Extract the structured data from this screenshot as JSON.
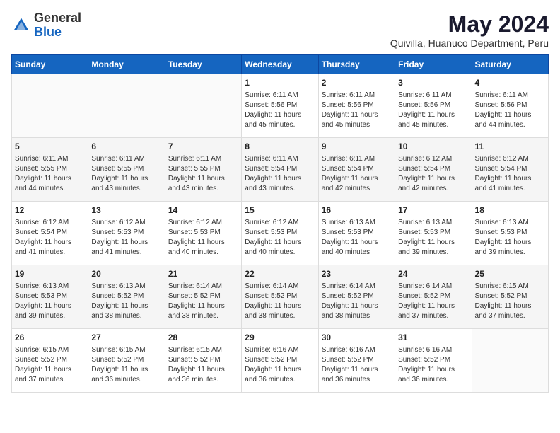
{
  "header": {
    "logo_general": "General",
    "logo_blue": "Blue",
    "month_year": "May 2024",
    "location": "Quivilla, Huanuco Department, Peru"
  },
  "days_of_week": [
    "Sunday",
    "Monday",
    "Tuesday",
    "Wednesday",
    "Thursday",
    "Friday",
    "Saturday"
  ],
  "weeks": [
    [
      {
        "day": "",
        "data": ""
      },
      {
        "day": "",
        "data": ""
      },
      {
        "day": "",
        "data": ""
      },
      {
        "day": "1",
        "data": "Sunrise: 6:11 AM\nSunset: 5:56 PM\nDaylight: 11 hours\nand 45 minutes."
      },
      {
        "day": "2",
        "data": "Sunrise: 6:11 AM\nSunset: 5:56 PM\nDaylight: 11 hours\nand 45 minutes."
      },
      {
        "day": "3",
        "data": "Sunrise: 6:11 AM\nSunset: 5:56 PM\nDaylight: 11 hours\nand 45 minutes."
      },
      {
        "day": "4",
        "data": "Sunrise: 6:11 AM\nSunset: 5:56 PM\nDaylight: 11 hours\nand 44 minutes."
      }
    ],
    [
      {
        "day": "5",
        "data": "Sunrise: 6:11 AM\nSunset: 5:55 PM\nDaylight: 11 hours\nand 44 minutes."
      },
      {
        "day": "6",
        "data": "Sunrise: 6:11 AM\nSunset: 5:55 PM\nDaylight: 11 hours\nand 43 minutes."
      },
      {
        "day": "7",
        "data": "Sunrise: 6:11 AM\nSunset: 5:55 PM\nDaylight: 11 hours\nand 43 minutes."
      },
      {
        "day": "8",
        "data": "Sunrise: 6:11 AM\nSunset: 5:54 PM\nDaylight: 11 hours\nand 43 minutes."
      },
      {
        "day": "9",
        "data": "Sunrise: 6:11 AM\nSunset: 5:54 PM\nDaylight: 11 hours\nand 42 minutes."
      },
      {
        "day": "10",
        "data": "Sunrise: 6:12 AM\nSunset: 5:54 PM\nDaylight: 11 hours\nand 42 minutes."
      },
      {
        "day": "11",
        "data": "Sunrise: 6:12 AM\nSunset: 5:54 PM\nDaylight: 11 hours\nand 41 minutes."
      }
    ],
    [
      {
        "day": "12",
        "data": "Sunrise: 6:12 AM\nSunset: 5:54 PM\nDaylight: 11 hours\nand 41 minutes."
      },
      {
        "day": "13",
        "data": "Sunrise: 6:12 AM\nSunset: 5:53 PM\nDaylight: 11 hours\nand 41 minutes."
      },
      {
        "day": "14",
        "data": "Sunrise: 6:12 AM\nSunset: 5:53 PM\nDaylight: 11 hours\nand 40 minutes."
      },
      {
        "day": "15",
        "data": "Sunrise: 6:12 AM\nSunset: 5:53 PM\nDaylight: 11 hours\nand 40 minutes."
      },
      {
        "day": "16",
        "data": "Sunrise: 6:13 AM\nSunset: 5:53 PM\nDaylight: 11 hours\nand 40 minutes."
      },
      {
        "day": "17",
        "data": "Sunrise: 6:13 AM\nSunset: 5:53 PM\nDaylight: 11 hours\nand 39 minutes."
      },
      {
        "day": "18",
        "data": "Sunrise: 6:13 AM\nSunset: 5:53 PM\nDaylight: 11 hours\nand 39 minutes."
      }
    ],
    [
      {
        "day": "19",
        "data": "Sunrise: 6:13 AM\nSunset: 5:53 PM\nDaylight: 11 hours\nand 39 minutes."
      },
      {
        "day": "20",
        "data": "Sunrise: 6:13 AM\nSunset: 5:52 PM\nDaylight: 11 hours\nand 38 minutes."
      },
      {
        "day": "21",
        "data": "Sunrise: 6:14 AM\nSunset: 5:52 PM\nDaylight: 11 hours\nand 38 minutes."
      },
      {
        "day": "22",
        "data": "Sunrise: 6:14 AM\nSunset: 5:52 PM\nDaylight: 11 hours\nand 38 minutes."
      },
      {
        "day": "23",
        "data": "Sunrise: 6:14 AM\nSunset: 5:52 PM\nDaylight: 11 hours\nand 38 minutes."
      },
      {
        "day": "24",
        "data": "Sunrise: 6:14 AM\nSunset: 5:52 PM\nDaylight: 11 hours\nand 37 minutes."
      },
      {
        "day": "25",
        "data": "Sunrise: 6:15 AM\nSunset: 5:52 PM\nDaylight: 11 hours\nand 37 minutes."
      }
    ],
    [
      {
        "day": "26",
        "data": "Sunrise: 6:15 AM\nSunset: 5:52 PM\nDaylight: 11 hours\nand 37 minutes."
      },
      {
        "day": "27",
        "data": "Sunrise: 6:15 AM\nSunset: 5:52 PM\nDaylight: 11 hours\nand 36 minutes."
      },
      {
        "day": "28",
        "data": "Sunrise: 6:15 AM\nSunset: 5:52 PM\nDaylight: 11 hours\nand 36 minutes."
      },
      {
        "day": "29",
        "data": "Sunrise: 6:16 AM\nSunset: 5:52 PM\nDaylight: 11 hours\nand 36 minutes."
      },
      {
        "day": "30",
        "data": "Sunrise: 6:16 AM\nSunset: 5:52 PM\nDaylight: 11 hours\nand 36 minutes."
      },
      {
        "day": "31",
        "data": "Sunrise: 6:16 AM\nSunset: 5:52 PM\nDaylight: 11 hours\nand 36 minutes."
      },
      {
        "day": "",
        "data": ""
      }
    ]
  ]
}
